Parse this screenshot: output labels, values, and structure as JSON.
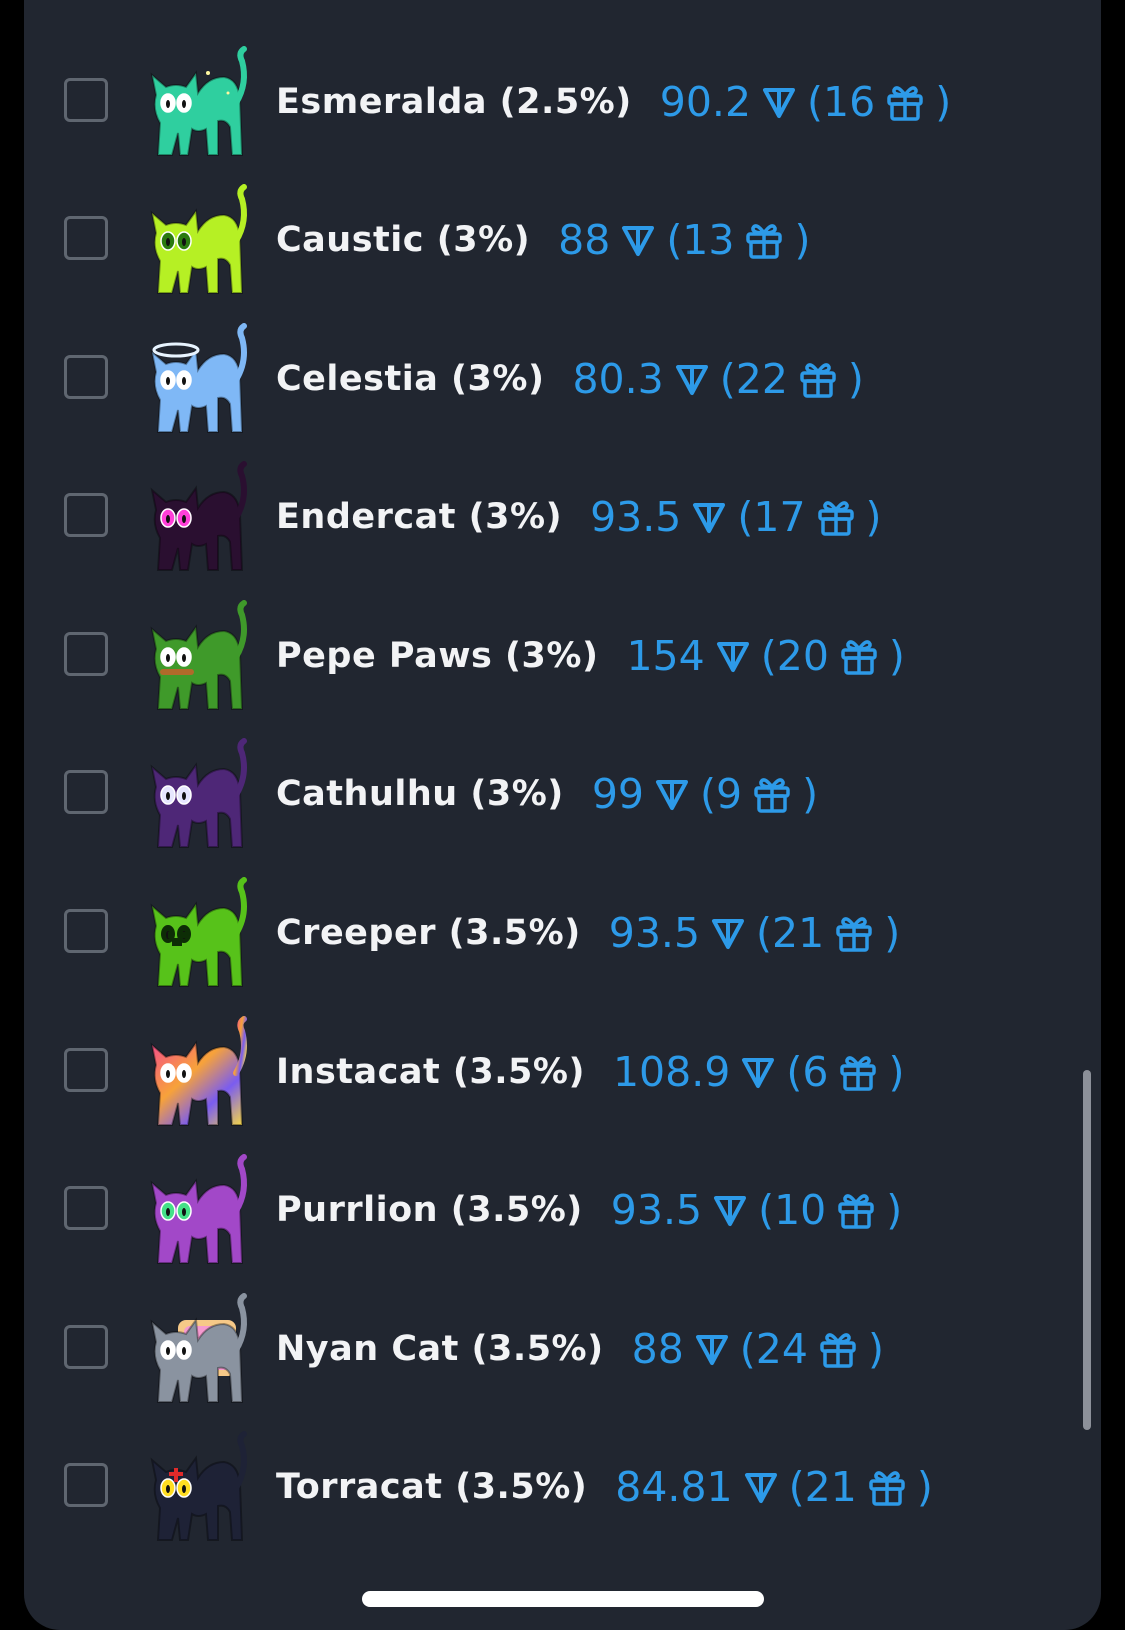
{
  "items": [
    {
      "name": "Esmeralda (2.5%)",
      "price": "90.2",
      "gifts_open": "(16",
      "gifts_close": ")",
      "color": "#2fcf9f",
      "eye": "#ffffff",
      "pattern": "sparkle"
    },
    {
      "name": "Caustic (3%)",
      "price": "88",
      "gifts_open": "(13",
      "gifts_close": ")",
      "color": "#b6f024",
      "eye": "#2a7a10",
      "pattern": "none"
    },
    {
      "name": "Celestia (3%)",
      "price": "80.3",
      "gifts_open": "(22",
      "gifts_close": ")",
      "color": "#7fb8f6",
      "eye": "#ffffff",
      "pattern": "halo"
    },
    {
      "name": "Endercat (3%)",
      "price": "93.5",
      "gifts_open": "(17",
      "gifts_close": ")",
      "color": "#2a0f30",
      "eye": "#ff3fd8",
      "pattern": "none"
    },
    {
      "name": "Pepe Paws (3%)",
      "price": "154",
      "gifts_open": "(20",
      "gifts_close": ")",
      "color": "#3f9a2a",
      "eye": "#ffffff",
      "pattern": "collar"
    },
    {
      "name": "Cathulhu (3%)",
      "price": "99",
      "gifts_open": "(9",
      "gifts_close": ")",
      "color": "#4e2777",
      "eye": "#e6e6ff",
      "pattern": "none"
    },
    {
      "name": "Creeper (3.5%)",
      "price": "93.5",
      "gifts_open": "(21",
      "gifts_close": ")",
      "color": "#57c21a",
      "eye": "#0d2d06",
      "pattern": "creeper"
    },
    {
      "name": "Instacat (3.5%)",
      "price": "108.9",
      "gifts_open": "(6",
      "gifts_close": ")",
      "color": "#f0517a",
      "eye": "#ffffff",
      "pattern": "rainbow"
    },
    {
      "name": "Purrlion (3.5%)",
      "price": "93.5",
      "gifts_open": "(10",
      "gifts_close": ")",
      "color": "#a248c8",
      "eye": "#44e088",
      "pattern": "none"
    },
    {
      "name": "Nyan Cat (3.5%)",
      "price": "88",
      "gifts_open": "(24",
      "gifts_close": ")",
      "color": "#8a93a0",
      "eye": "#ffffff",
      "pattern": "nyan"
    },
    {
      "name": "Torracat (3.5%)",
      "price": "84.81",
      "gifts_open": "(21",
      "gifts_close": ")",
      "color": "#1e2236",
      "eye": "#ffdd22",
      "pattern": "torra"
    }
  ],
  "colors": {
    "background": "#212630",
    "accent": "#2d9ae8",
    "text": "#f2f3f5",
    "checkbox_border": "#5f6670"
  },
  "icons": {
    "currency": "ton-icon",
    "gifts": "gift-icon",
    "checkbox": "checkbox-unchecked"
  }
}
